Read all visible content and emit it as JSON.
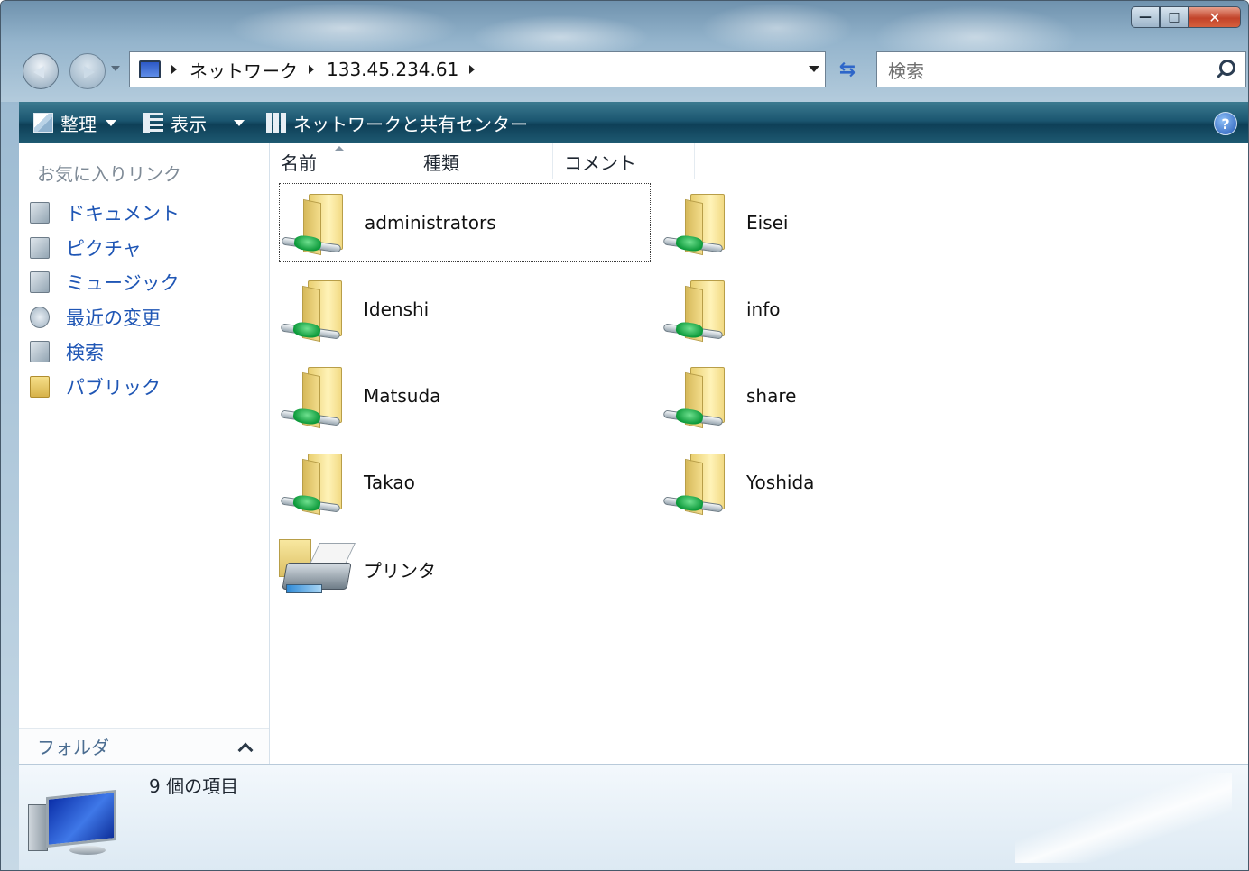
{
  "window": {
    "caption": {
      "minimize": "—",
      "maximize": "□",
      "close": "✕"
    }
  },
  "address_bar": {
    "crumbs": [
      "ネットワーク",
      "133.45.234.61"
    ]
  },
  "search": {
    "placeholder": "検索"
  },
  "toolbar": {
    "organize": "整理",
    "views": "表示",
    "network_center": "ネットワークと共有センター",
    "help": "?"
  },
  "nav_pane": {
    "favorites_title": "お気に入りリンク",
    "links": [
      {
        "label": "ドキュメント",
        "icon": "documents-icon"
      },
      {
        "label": "ピクチャ",
        "icon": "pictures-icon"
      },
      {
        "label": "ミュージック",
        "icon": "music-icon"
      },
      {
        "label": "最近の変更",
        "icon": "recent-changes-icon"
      },
      {
        "label": "検索",
        "icon": "searches-icon"
      },
      {
        "label": "パブリック",
        "icon": "public-folder-icon"
      }
    ],
    "folders_label": "フォルダ"
  },
  "columns": [
    "名前",
    "種類",
    "コメント"
  ],
  "items": [
    {
      "label": "administrators",
      "icon": "shared-folder-icon",
      "selected": true
    },
    {
      "label": "Eisei",
      "icon": "shared-folder-icon"
    },
    {
      "label": "Idenshi",
      "icon": "shared-folder-icon"
    },
    {
      "label": "info",
      "icon": "shared-folder-icon"
    },
    {
      "label": "Matsuda",
      "icon": "shared-folder-icon"
    },
    {
      "label": "share",
      "icon": "shared-folder-icon"
    },
    {
      "label": "Takao",
      "icon": "shared-folder-icon"
    },
    {
      "label": "Yoshida",
      "icon": "shared-folder-icon"
    },
    {
      "label": "プリンタ",
      "icon": "printers-folder-icon"
    }
  ],
  "details": {
    "item_count": "9 個の項目"
  },
  "colors": {
    "toolbar": "#1b5670",
    "link": "#1f56b5",
    "close_button": "#c2432a"
  }
}
